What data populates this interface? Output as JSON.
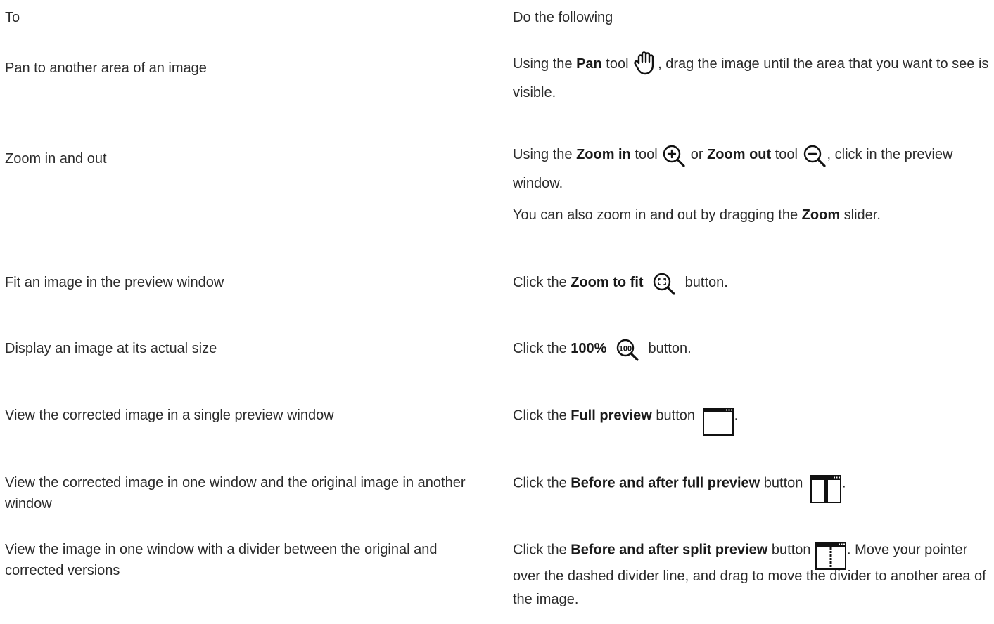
{
  "header": {
    "col1": "To",
    "col2": "Do the following"
  },
  "rows": [
    {
      "to": "Pan to another area of an image",
      "p1a": "Using the ",
      "b1": "Pan",
      "p1b": " tool ",
      "icon1": "pan-hand-icon",
      "p1c": ", drag the image until the area that you want to see is visible."
    },
    {
      "to": "Zoom in and out",
      "p1a": "Using the ",
      "b1": "Zoom in",
      "p1b": " tool ",
      "icon1": "zoom-in-icon",
      "p1c": " or ",
      "b2": "Zoom out",
      "p1d": " tool ",
      "icon2": "zoom-out-icon",
      "p1e": ", click in the preview window.",
      "p2a": "You can also zoom in and out by dragging the ",
      "p2b": "Zoom",
      "p2c": " slider."
    },
    {
      "to": "Fit an image in the preview window",
      "p1a": "Click the ",
      "b1": "Zoom to fit",
      "icon1": "zoom-to-fit-icon",
      "p1b": " button."
    },
    {
      "to": "Display an image at its actual size",
      "p1a": "Click the ",
      "b1": "100%",
      "icon1": "zoom-100-icon",
      "icon_text": "100",
      "p1b": " button."
    },
    {
      "to": "View the corrected image in a single preview window",
      "p1a": "Click the ",
      "b1": "Full preview",
      "p1b": " button",
      "icon1": "full-preview-icon",
      "p1c": "."
    },
    {
      "to": "View the corrected image in one window and the original image in another window",
      "p1a": "Click the ",
      "b1": "Before and after full preview",
      "p1b": " button",
      "icon1": "before-after-full-preview-icon",
      "p1c": "."
    },
    {
      "to": "View the image in one window with a divider between the original and corrected versions",
      "p1a": "Click the ",
      "b1": "Before and after split preview",
      "p1b": " button ",
      "icon1": "before-after-split-preview-icon",
      "p1c": ". Move your pointer over the dashed divider line, and drag to move the divider to another area of the image."
    }
  ]
}
